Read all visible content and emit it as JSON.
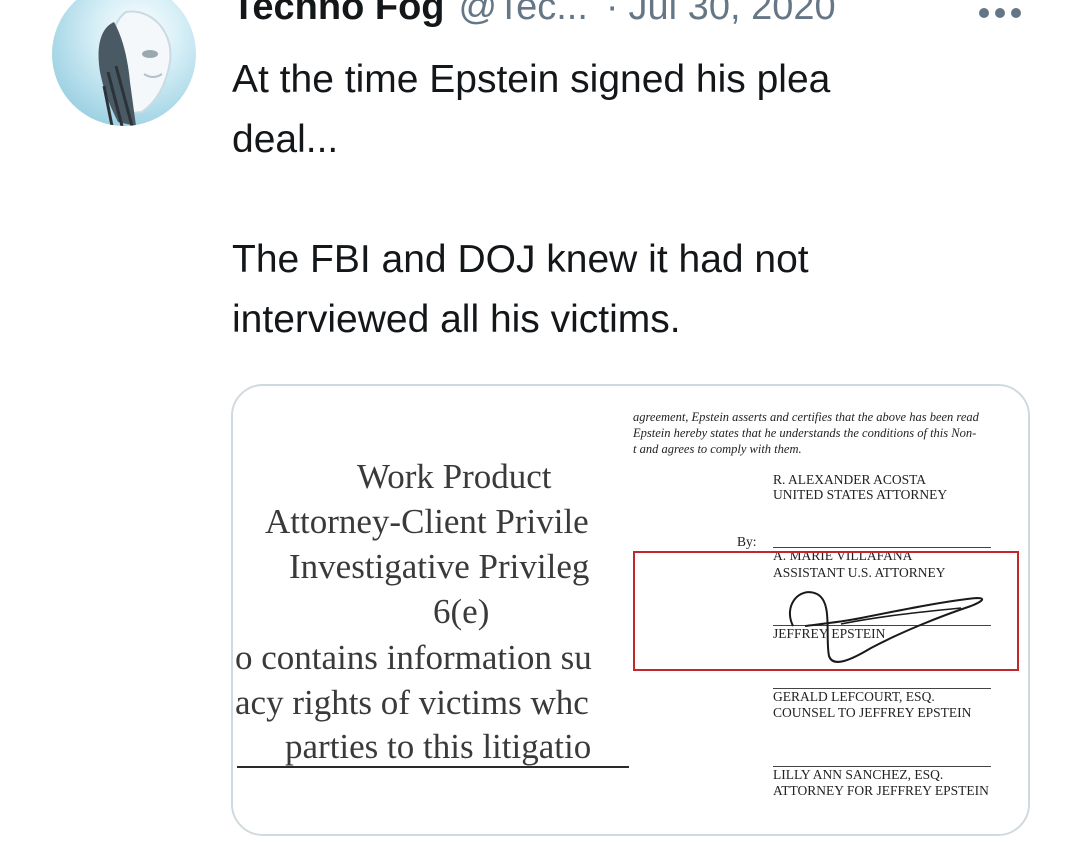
{
  "tweet": {
    "author_name": "Techno Fog",
    "handle": "@Tec...",
    "separator": "·",
    "date": "Jul 30, 2020",
    "more_icon": "more-horizontal-icon",
    "text": "At the time Epstein signed his plea\ndeal...\n\nThe FBI and DOJ knew it had not\ninterviewed all his victims."
  },
  "media": {
    "left_doc": {
      "line1": "Work Product",
      "line2": "Attorney-Client Privile",
      "line3": "Investigative Privileg",
      "line4": "6(e)",
      "line5": "o contains information su",
      "line6": "acy rights of victims whc",
      "line7": "parties to this litigatio"
    },
    "right_doc": {
      "intro1": "agreement, Epstein asserts and certifies that the above has been read",
      "intro2": "Epstein hereby states that he understands the conditions of this Non-",
      "intro3": "t and agrees to comply with them.",
      "acosta_name": "R. ALEXANDER ACOSTA",
      "acosta_title": "UNITED STATES ATTORNEY",
      "by_label": "By:",
      "villafana_name": "A. MARIE VILLAFANA",
      "villafana_title": "ASSISTANT U.S. ATTORNEY",
      "epstein_name": "JEFFREY EPSTEIN",
      "lefcourt_name": "GERALD LEFCOURT, ESQ.",
      "lefcourt_title": "COUNSEL TO JEFFREY EPSTEIN",
      "sanchez_name": "LILLY ANN SANCHEZ, ESQ.",
      "sanchez_title": "ATTORNEY FOR JEFFREY EPSTEIN"
    },
    "highlight_color": "#c0282d"
  },
  "colors": {
    "text": "#14171a",
    "secondary": "#657786",
    "border": "#cfd9de"
  }
}
